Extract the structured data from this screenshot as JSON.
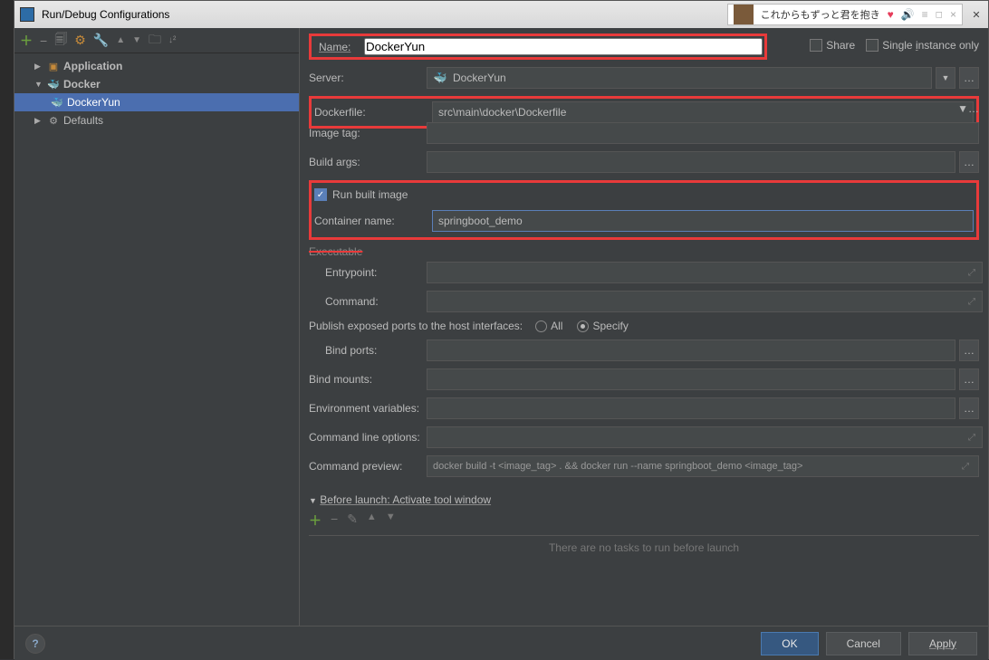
{
  "titlebar": {
    "title": "Run/Debug Configurations",
    "jp_text": "これからもずっと君を抱き"
  },
  "toolbar_icons": [
    "add",
    "remove",
    "copy",
    "save",
    "up",
    "down",
    "folder",
    "sort"
  ],
  "tree": {
    "application": "Application",
    "docker": "Docker",
    "dockeryun": "DockerYun",
    "defaults": "Defaults"
  },
  "form": {
    "name_label": "Name:",
    "name_value": "DockerYun",
    "share_label": "Share",
    "single_instance_label": "Single instance only",
    "server_label": "Server:",
    "server_value": "DockerYun",
    "dockerfile_label": "Dockerfile:",
    "dockerfile_value": "src\\main\\docker\\Dockerfile",
    "image_tag_label": "Image tag:",
    "image_tag_value": "",
    "build_args_label": "Build args:",
    "build_args_value": "",
    "run_built_label": "Run built image",
    "container_name_label": "Container name:",
    "container_name_value": "springboot_demo",
    "executable_label": "Executable",
    "entrypoint_label": "Entrypoint:",
    "entrypoint_value": "",
    "command_label": "Command:",
    "command_value": "",
    "publish_label": "Publish exposed ports to the host interfaces:",
    "publish_all": "All",
    "publish_specify": "Specify",
    "bind_ports_label": "Bind ports:",
    "bind_ports_value": "",
    "bind_mounts_label": "Bind mounts:",
    "bind_mounts_value": "",
    "env_label": "Environment variables:",
    "env_value": "",
    "cmdline_label": "Command line options:",
    "cmdline_value": "",
    "preview_label": "Command preview:",
    "preview_value": "docker build -t <image_tag> . && docker run --name springboot_demo <image_tag>",
    "before_launch_title": "Before launch: Activate tool window",
    "before_launch_empty": "There are no tasks to run before launch"
  },
  "footer": {
    "ok": "OK",
    "cancel": "Cancel",
    "apply": "Apply"
  }
}
